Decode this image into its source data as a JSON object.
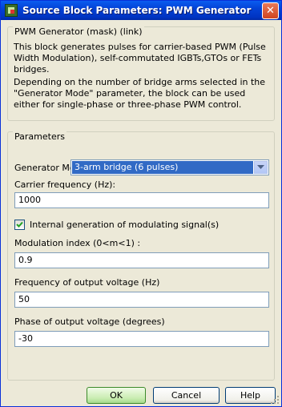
{
  "window": {
    "title": "Source Block Parameters: PWM Generator",
    "close_glyph": "✕"
  },
  "mask": {
    "group_title": "PWM Generator (mask) (link)",
    "description_1": "This block generates pulses for carrier-based PWM (Pulse Width Modulation), self-commutated IGBTs,GTOs or FETs bridges.",
    "description_2": "Depending on the number of bridge arms selected in the \"Generator Mode\" parameter, the block can be used either for single-phase or three-phase PWM control."
  },
  "parameters": {
    "group_title": "Parameters",
    "generator_mode": {
      "label": "Generator Mode",
      "selected": "3-arm  bridge (6 pulses)"
    },
    "carrier_frequency": {
      "label": "Carrier frequency (Hz):",
      "value": "1000"
    },
    "internal_generation": {
      "label": "Internal generation of modulating signal(s)",
      "checked": true
    },
    "modulation_index": {
      "label": "Modulation index  (0<m<1) :",
      "value": "0.9"
    },
    "output_frequency": {
      "label": "Frequency of output voltage (Hz)",
      "value": "50"
    },
    "output_phase": {
      "label": "Phase of output voltage (degrees)",
      "value": "-30"
    }
  },
  "buttons": {
    "ok": "OK",
    "cancel": "Cancel",
    "help": "Help"
  },
  "icons": {
    "app": "simulink-block-icon",
    "close": "close-icon",
    "dropdown": "chevron-down-icon",
    "check": "checkmark-icon",
    "grip": "resize-grip-icon"
  },
  "colors": {
    "titlebar": "#0342d6",
    "selection": "#316ac5",
    "dialog_bg": "#ece9d8",
    "field_border": "#7f9db9"
  }
}
